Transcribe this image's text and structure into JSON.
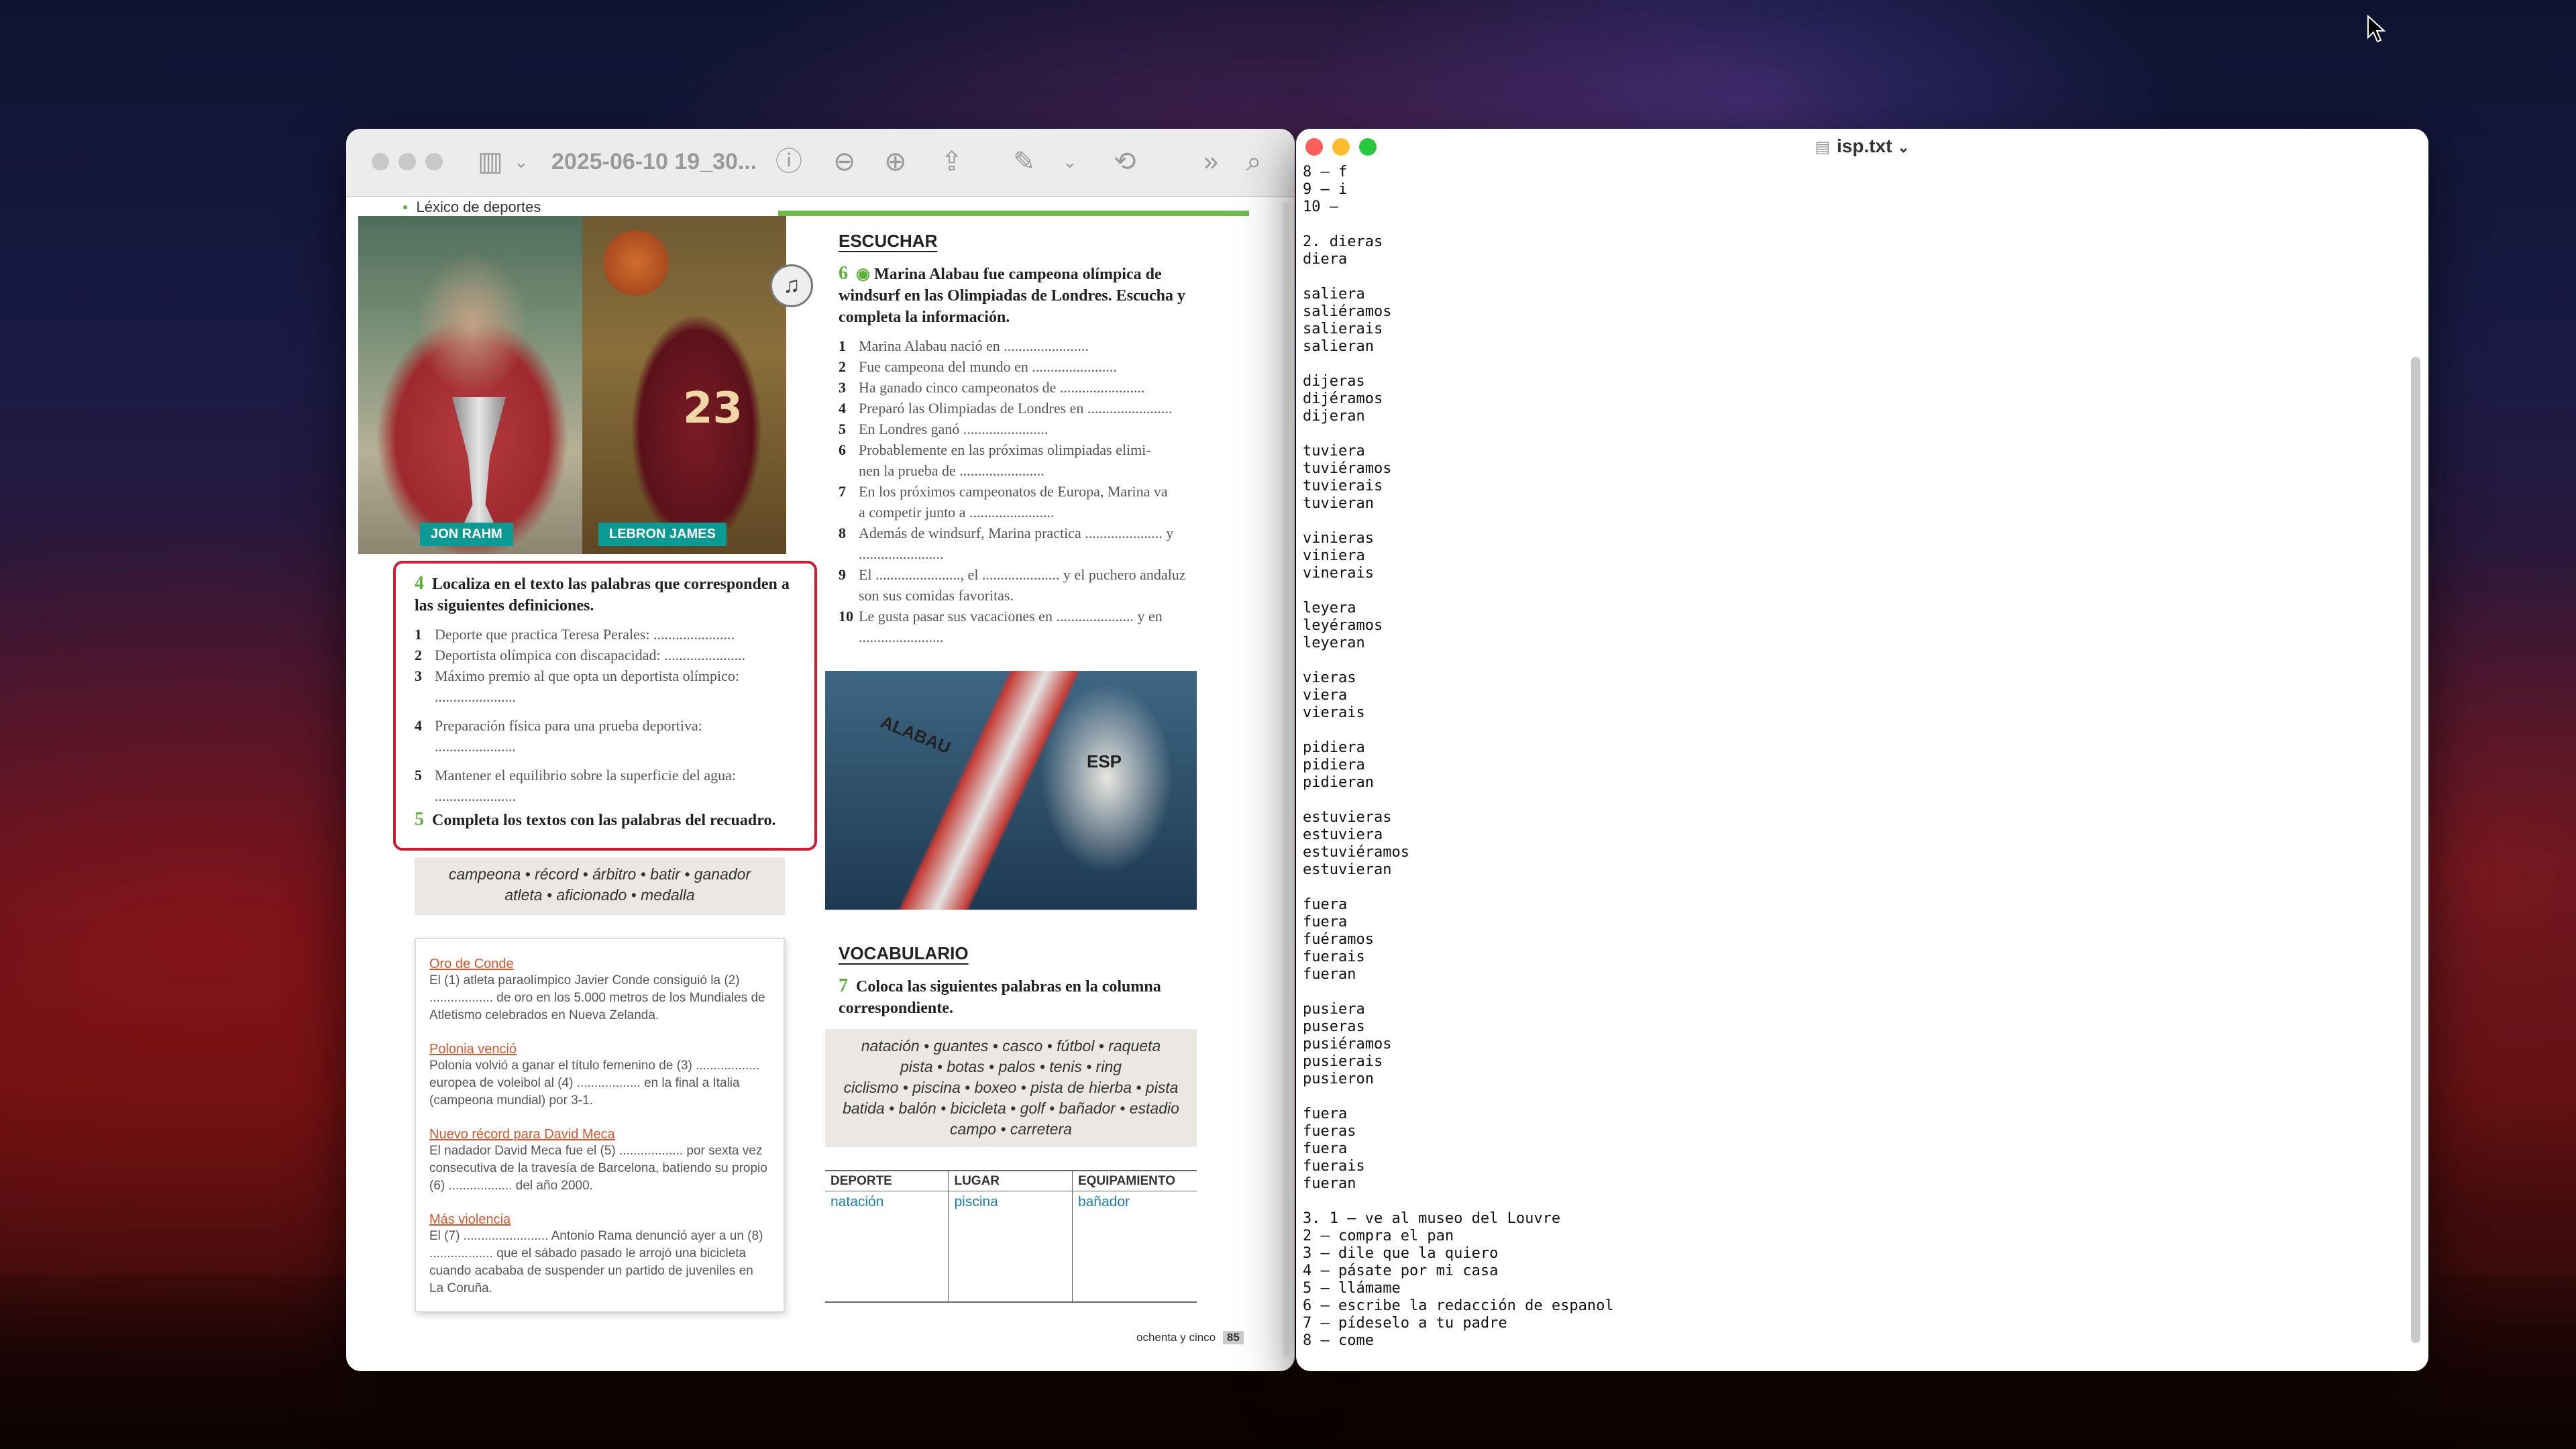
{
  "preview": {
    "title": "2025-06-10 19_30...",
    "section_label": "Léxico de deportes",
    "photo_labels": {
      "rahm": "JON RAHM",
      "james": "LEBRON JAMES"
    },
    "jersey_number": "23",
    "escuchar": {
      "heading": "ESCUCHAR",
      "number": "6",
      "title": "Marina Alabau fue campeona olímpica de windsurf en las Olimpiadas de Londres. Escucha y completa la información.",
      "items": [
        {
          "n": "1",
          "t": "Marina Alabau nació en ......................."
        },
        {
          "n": "2",
          "t": "Fue campeona del mundo en ......................."
        },
        {
          "n": "3",
          "t": "Ha ganado cinco campeonatos de ......................."
        },
        {
          "n": "4",
          "t": "Preparó las Olimpiadas de Londres en ......................."
        },
        {
          "n": "5",
          "t": "En Londres ganó ......................."
        },
        {
          "n": "6",
          "t": "Probablemente en las próximas olimpiadas elimi-"
        },
        {
          "n": "",
          "t": "nen la prueba de ......................."
        },
        {
          "n": "7",
          "t": "En los próximos campeonatos de Europa, Marina va"
        },
        {
          "n": "",
          "t": "a competir junto a ......................."
        },
        {
          "n": "8",
          "t": "Además de windsurf, Marina practica ..................... y"
        },
        {
          "n": "",
          "t": "......................."
        },
        {
          "n": "9",
          "t": "El ......................., el ..................... y el puchero andaluz"
        },
        {
          "n": "",
          "t": "son sus comidas favoritas."
        },
        {
          "n": "10",
          "t": "Le gusta pasar sus vacaciones en ..................... y en"
        },
        {
          "n": "",
          "t": "......................."
        }
      ]
    },
    "ex4": {
      "number": "4",
      "title": "Localiza en el texto las palabras que corresponden a las siguientes definiciones.",
      "items": [
        {
          "n": "1",
          "t": "Deporte que practica Teresa Perales: ......................"
        },
        {
          "n": "2",
          "t": "Deportista olímpica con discapacidad: ......................"
        },
        {
          "n": "3",
          "t": "Máximo premio al que opta un deportista olímpico:"
        },
        {
          "n": "",
          "t": "......................"
        },
        {
          "n": "",
          "t": ""
        },
        {
          "n": "4",
          "t": "Preparación física para una prueba deportiva:"
        },
        {
          "n": "",
          "t": "......................"
        },
        {
          "n": "",
          "t": ""
        },
        {
          "n": "5",
          "t": "Mantener el equilibrio sobre la superficie del agua:"
        },
        {
          "n": "",
          "t": "......................"
        }
      ]
    },
    "ex5": {
      "number": "5",
      "title": "Completa los textos con las palabras del recuadro.",
      "words_line1": "campeona • récord • árbitro • batir • ganador",
      "words_line2": "atleta • aficionado • medalla"
    },
    "texts": [
      {
        "head": "Oro de Conde",
        "body": "El (1) atleta paraolímpico Javier Conde consiguió la (2) .................. de oro en los 5.000 metros de los Mundiales de Atletismo celebrados en Nueva Zelanda."
      },
      {
        "head": "Polonia venció",
        "body": "Polonia volvió a ganar el título femenino de (3) .................. europea de voleibol al (4) .................. en la final a Italia (campeona mundial) por 3-1."
      },
      {
        "head": "Nuevo récord para David Meca",
        "body": "El nadador David Meca fue el (5) .................. por sexta vez consecutiva de la travesía de Barcelona, batiendo su propio (6) .................. del año 2000."
      },
      {
        "head": "Más violencia",
        "body": "El (7) ........................ Antonio Rama denunció ayer a un (8) .................. que el sábado pasado le arrojó una bicicleta cuando acababa de suspender un partido de juveniles en La Coruña."
      }
    ],
    "windsurf_photo": {
      "sail": "ALABAU",
      "bib": "ESP"
    },
    "vocab": {
      "heading": "VOCABULARIO",
      "number": "7",
      "title": "Coloca las siguientes palabras en la columna correspondiente.",
      "word_lines": [
        "natación • guantes • casco • fútbol • raqueta",
        "pista • botas • palos • tenis • ring",
        "ciclismo • piscina • boxeo • pista de hierba • pista",
        "batida • balón • bicicleta • golf • bañador • estadio",
        "campo • carretera"
      ],
      "columns": [
        "DEPORTE",
        "LUGAR",
        "EQUIPAMIENTO"
      ],
      "examples": [
        "natación",
        "piscina",
        "bañador"
      ]
    },
    "footer": "ochenta y cinco",
    "page_number": "85"
  },
  "textedit": {
    "filename": "isp.txt",
    "content": "8 – f\n9 – i\n10 –\n\n2. dieras\ndiera\n\nsaliera\nsaliéramos\nsalierais\nsalieran\n\ndijeras\ndijéramos\ndijeran\n\ntuviera\ntuviéramos\ntuvierais\ntuvieran\n\nvinieras\nviniera\nvinerais\n\nleyera\nleyéramos\nleyeran\n\nvieras\nviera\nvierais\n\npidiera\npidiera\npidieran\n\nestuvieras\nestuviera\nestuviéramos\nestuvieran\n\nfuera\nfuera\nfuéramos\nfuerais\nfueran\n\npusiera\npuseras\npusiéramos\npusierais\npusieron\n\nfuera\nfueras\nfuera\nfuerais\nfueran\n\n3. 1 – ve al museo del Louvre\n2 – compra el pan\n3 – dile que la quiero\n4 – pásate por mi casa\n5 – llámame\n6 – escribe la redacción de espanol\n7 – pídeselo a tu padre\n8 – come"
  },
  "colors": {
    "accent_green": "#6cbd46",
    "highlight_red": "#d11a34",
    "teal_label": "#0c9a95",
    "close": "#ff5f57",
    "minimize": "#febc2e",
    "zoom": "#28c840"
  }
}
